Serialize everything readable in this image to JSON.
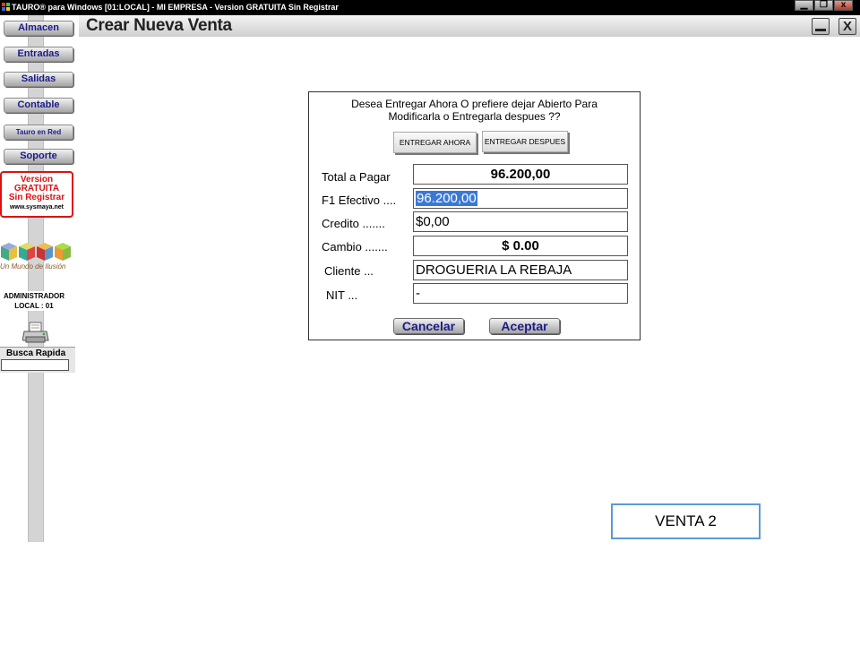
{
  "window": {
    "title": "TAURO® para Windows  [01:LOCAL] - MI EMPRESA - Version GRATUITA Sin Registrar",
    "controls": {
      "minimize": "▁",
      "restore": "❐",
      "close": "x"
    }
  },
  "header": {
    "title": "Crear Nueva Venta",
    "minimize_label": "",
    "close_label": "X"
  },
  "sidebar": {
    "items": [
      {
        "label": "Almacen"
      },
      {
        "label": "Entradas"
      },
      {
        "label": "Salidas"
      },
      {
        "label": "Contable"
      },
      {
        "label": "Tauro en Red"
      },
      {
        "label": "Soporte"
      }
    ],
    "promo": {
      "line1": "Version",
      "line2": "GRATUITA",
      "line3": "Sin Registrar",
      "url": "www.sysmaya.net"
    },
    "logo_text": "Un Mundo de Ilusión",
    "user": {
      "line1": "ADMINISTRADOR",
      "line2": "LOCAL : 01"
    },
    "busca": {
      "label": "Busca Rapida",
      "value": ""
    }
  },
  "dialog": {
    "question_line1": "Desea Entregar Ahora O prefiere dejar Abierto Para",
    "question_line2": "Modificarla o Entregarla despues ??",
    "entregar_ahora": "ENTREGAR AHORA",
    "entregar_despues": "ENTREGAR DESPUES",
    "rows": {
      "total": {
        "label": "Total a Pagar",
        "value": "96.200,00"
      },
      "efectivo": {
        "label": "F1  Efectivo ....",
        "value": "96.200,00"
      },
      "credito": {
        "label": "Credito .......",
        "value": "$0,00"
      },
      "cambio": {
        "label": "Cambio .......",
        "value": "$ 0.00"
      },
      "cliente": {
        "label": "Cliente ...",
        "value": "DROGUERIA LA REBAJA"
      },
      "nit": {
        "label": "NIT ...",
        "value": "-"
      }
    },
    "cancel_label": "Cancelar",
    "accept_label": "Aceptar"
  },
  "annotation": {
    "label": "VENTA  2"
  },
  "colors": {
    "titlebar": "#000000",
    "nav_text": "#1b1b8a",
    "promo_red": "#dd1111",
    "selection": "#3b78d6",
    "annotation_border": "#5b9bd5"
  }
}
